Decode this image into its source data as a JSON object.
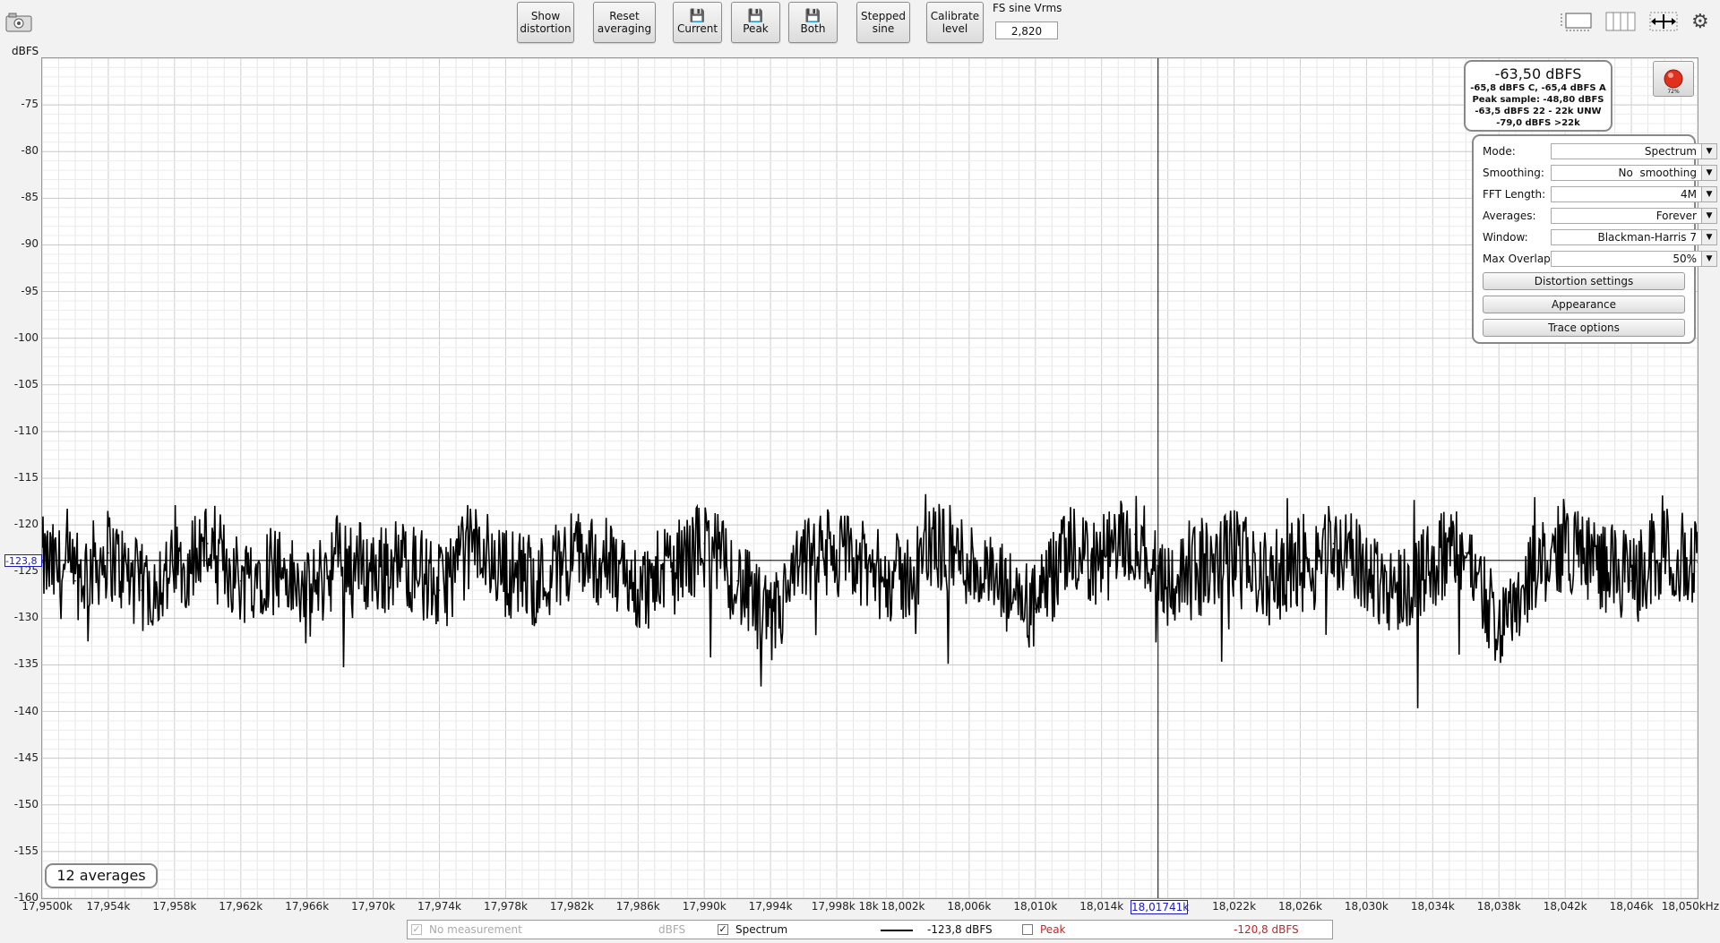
{
  "toolbar": {
    "show_distortion": "Show distortion",
    "reset_averaging": "Reset averaging",
    "save_current": "Current",
    "save_peak": "Peak",
    "save_both": "Both",
    "stepped_sine": "Stepped sine",
    "calibrate_level": "Calibrate level",
    "fs_sine_label": "FS sine Vrms",
    "fs_sine_value": "2,820"
  },
  "icons": {
    "camera": "camera-icon",
    "disk": "floppy-disk-icon",
    "layout_a": "graph-layout-icon",
    "layout_b": "split-view-icon",
    "fit": "fit-arrows-icon",
    "settings": "gear-icon",
    "record": "record-icon"
  },
  "readout": {
    "main": "-63,50 dBFS",
    "line1": "-65,8 dBFS C, -65,4 dBFS A",
    "line2": "Peak sample: -48,80 dBFS",
    "line3": "-63,5 dBFS 22 - 22k UNW",
    "line4": "-79,0 dBFS >22k",
    "record_pct": "72%"
  },
  "controls": {
    "mode_label": "Mode:",
    "mode_value": "Spectrum",
    "smoothing_label": "Smoothing:",
    "smoothing_value": "No  smoothing",
    "fft_label": "FFT Length:",
    "fft_value": "4M",
    "averages_label": "Averages:",
    "averages_value": "Forever",
    "window_label": "Window:",
    "window_value": "Blackman-Harris 7",
    "overlap_label": "Max Overlap:",
    "overlap_value": "50%",
    "distortion_settings": "Distortion settings",
    "appearance": "Appearance",
    "trace_options": "Trace options"
  },
  "averages_badge": "12 averages",
  "cursor": {
    "y_readout": "-123,8",
    "x_readout": "18,01741k"
  },
  "legend": {
    "no_measurement": "No measurement",
    "no_measurement_unit": "dBFS",
    "spectrum": "Spectrum",
    "spectrum_value": "-123,8 dBFS",
    "peak": "Peak",
    "peak_value": "-120,8 dBFS"
  },
  "colors": {
    "trace": "#000000",
    "peak": "#cc2222",
    "cursor_readout": "#1a1acc",
    "record": "#e0301e"
  },
  "chart_data": {
    "type": "line",
    "ylabel": "dBFS",
    "xlabel": "",
    "ylim": [
      -160,
      -70
    ],
    "xlim": [
      17950,
      18050
    ],
    "grid": true,
    "ytick_labels": [
      "-75",
      "-80",
      "-85",
      "-90",
      "-95",
      "-100",
      "-105",
      "-110",
      "-115",
      "-120",
      "-125",
      "-130",
      "-135",
      "-140",
      "-145",
      "-150",
      "-155",
      "-160"
    ],
    "ytick_values": [
      -75,
      -80,
      -85,
      -90,
      -95,
      -100,
      -105,
      -110,
      -115,
      -120,
      -125,
      -130,
      -135,
      -140,
      -145,
      -150,
      -155,
      -160
    ],
    "xtick_labels": [
      "17,9500k",
      "17,954k",
      "17,958k",
      "17,962k",
      "17,966k",
      "17,970k",
      "17,974k",
      "17,978k",
      "17,982k",
      "17,986k",
      "17,990k",
      "17,994k",
      "17,998k 18k",
      "18,002k",
      "18,006k",
      "18,010k",
      "18,014k",
      "18,022k",
      "18,026k",
      "18,030k",
      "18,034k",
      "18,038k",
      "18,042k",
      "18,046k",
      "18,050kHz"
    ],
    "xtick_values": [
      17950,
      17954,
      17958,
      17962,
      17966,
      17970,
      17974,
      17978,
      17982,
      17986,
      17990,
      17994,
      17998.5,
      18002,
      18006,
      18010,
      18014,
      18022,
      18026,
      18030,
      18034,
      18038,
      18042,
      18046,
      18050
    ],
    "series": [
      {
        "name": "Spectrum",
        "x": [
          17950,
          17952,
          17954,
          17956,
          17958,
          17960,
          17962,
          17964,
          17966,
          17968,
          17970,
          17972,
          17974,
          17976,
          17978,
          17980,
          17982,
          17984,
          17986,
          17988,
          17990,
          17992,
          17994,
          17996,
          17998,
          18000,
          18002,
          18004,
          18006,
          18008,
          18010,
          18012,
          18014,
          18016,
          18018,
          18020,
          18022,
          18024,
          18026,
          18028,
          18030,
          18032,
          18034,
          18036,
          18038,
          18040,
          18042,
          18044,
          18046,
          18048,
          18050
        ],
        "values": [
          -124,
          -126,
          -123,
          -127,
          -125,
          -122,
          -126,
          -124,
          -128,
          -123,
          -125,
          -124,
          -127,
          -122,
          -125,
          -126,
          -123,
          -124,
          -127,
          -125,
          -122,
          -126,
          -131,
          -124,
          -123,
          -125,
          -126,
          -122,
          -124,
          -127,
          -129,
          -123,
          -124,
          -121,
          -126,
          -125,
          -123,
          -126,
          -124,
          -122,
          -125,
          -127,
          -124,
          -123,
          -131,
          -125,
          -122,
          -124,
          -126,
          -123,
          -124
        ]
      }
    ],
    "cursor_y": -123.8,
    "cursor_x": 18017.41
  }
}
